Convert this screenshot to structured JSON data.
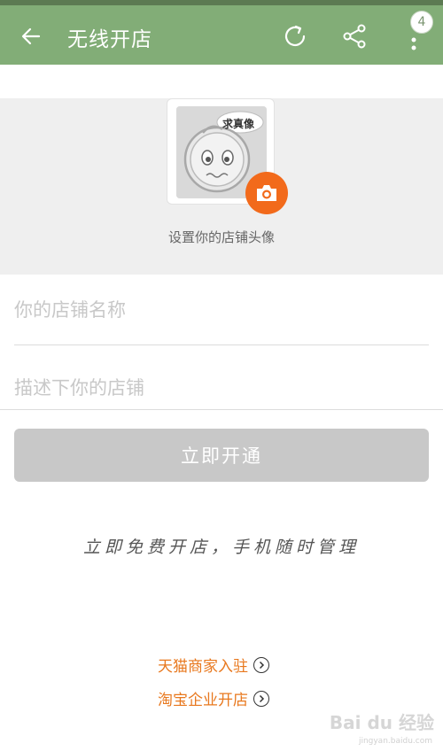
{
  "appbar": {
    "title": "无线开店",
    "badge_count": "4",
    "icons": [
      "back-arrow-icon",
      "refresh-icon",
      "share-icon",
      "more-vertical-icon"
    ]
  },
  "avatar": {
    "sticker_text": "求真像",
    "caption": "设置你的店铺头像"
  },
  "form": {
    "name_placeholder": "你的店铺名称",
    "desc_placeholder": "描述下你的店铺"
  },
  "submit": {
    "label": "立即开通"
  },
  "slogan": "立即免费开店，手机随时管理",
  "links": {
    "tmall": "天猫商家入驻",
    "taobao": "淘宝企业开店"
  },
  "watermark": {
    "brand": "Bai du 经验",
    "url": "jingyan.baidu.com"
  },
  "colors": {
    "appbar": "#82ad77",
    "accent": "#f26a1b",
    "link": "#e8781e",
    "button_disabled": "#c8c8c8"
  }
}
